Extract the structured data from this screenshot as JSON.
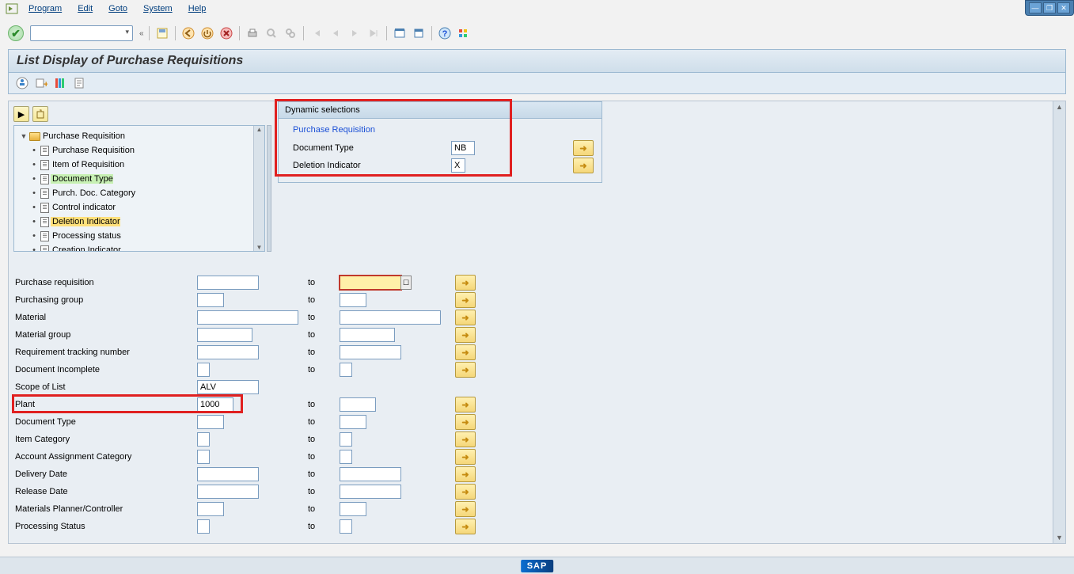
{
  "menu": {
    "program": "Program",
    "edit": "Edit",
    "goto": "Goto",
    "system": "System",
    "help": "Help"
  },
  "title": "List Display of Purchase Requisitions",
  "dyn": {
    "title": "Dynamic selections",
    "link": "Purchase Requisition",
    "doc_type_label": "Document Type",
    "doc_type_value": "NB",
    "del_ind_label": "Deletion Indicator",
    "del_ind_value": "X"
  },
  "tree": {
    "root": "Purchase Requisition",
    "items": [
      "Purchase Requisition",
      "Item of Requisition",
      "Document Type",
      "Purch. Doc. Category",
      "Control indicator",
      "Deletion Indicator",
      "Processing status",
      "Creation Indicator"
    ]
  },
  "to_label": "to",
  "fields": {
    "purreq": {
      "label": "Purchase requisition",
      "from": "",
      "to": ""
    },
    "purgrp": {
      "label": "Purchasing group",
      "from": "",
      "to": ""
    },
    "material": {
      "label": "Material",
      "from": "",
      "to": ""
    },
    "matgrp": {
      "label": "Material group",
      "from": "",
      "to": ""
    },
    "reqtrack": {
      "label": "Requirement tracking number",
      "from": "",
      "to": ""
    },
    "docinc": {
      "label": "Document Incomplete",
      "from": "",
      "to": ""
    },
    "scope": {
      "label": "Scope of List",
      "from": "ALV"
    },
    "plant": {
      "label": "Plant",
      "from": "1000",
      "to": ""
    },
    "doctype": {
      "label": "Document Type",
      "from": "",
      "to": ""
    },
    "itemcat": {
      "label": "Item Category",
      "from": "",
      "to": ""
    },
    "acctasn": {
      "label": "Account Assignment Category",
      "from": "",
      "to": ""
    },
    "delvdate": {
      "label": "Delivery Date",
      "from": "",
      "to": ""
    },
    "reldate": {
      "label": "Release Date",
      "from": "",
      "to": ""
    },
    "mrpctrl": {
      "label": "Materials Planner/Controller",
      "from": "",
      "to": ""
    },
    "procstat": {
      "label": "Processing Status",
      "from": "",
      "to": ""
    }
  },
  "logo": "SAP"
}
